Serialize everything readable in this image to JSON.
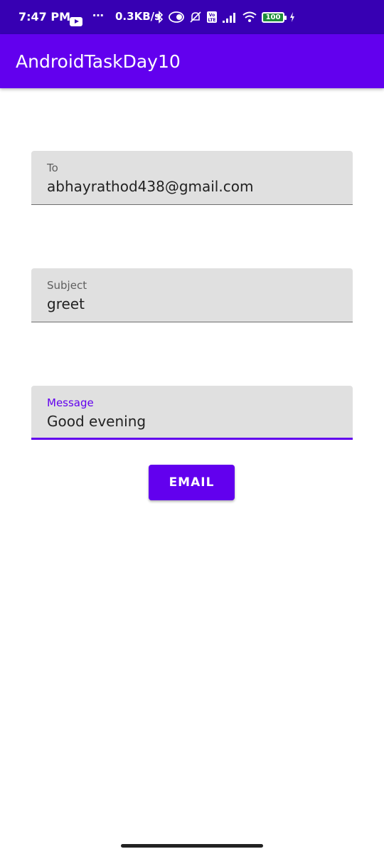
{
  "status_bar": {
    "time": "7:47 PM",
    "dots": "⋯",
    "net_speed": "0.3KB/s",
    "battery_level": "100",
    "icons": [
      "youtube-icon",
      "bluetooth-icon",
      "data-saver-icon",
      "alarm-off-icon",
      "volte-icon",
      "signal-icon",
      "wifi-icon",
      "battery-icon",
      "charging-icon"
    ]
  },
  "app_bar": {
    "title": "AndroidTaskDay10",
    "color": "#6200ee"
  },
  "form": {
    "to": {
      "label": "To",
      "value": "abhayrathod438@gmail.com"
    },
    "subject": {
      "label": "Subject",
      "value": "greet"
    },
    "message": {
      "label": "Message",
      "value": "Good evening"
    }
  },
  "email_button": {
    "label": "EMAIL"
  },
  "colors": {
    "status_bar": "#3700b3",
    "primary": "#6200ee",
    "field_bg": "#e0e0e0"
  }
}
